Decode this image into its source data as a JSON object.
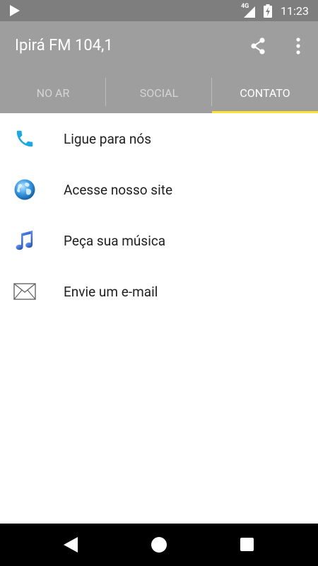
{
  "status_bar": {
    "network_label": "4G",
    "time": "11:23"
  },
  "app_bar": {
    "title": "Ipirá FM 104,1",
    "share_icon": "share-icon",
    "more_icon": "more-vert-icon",
    "background_color": "#9e9e9e"
  },
  "tabs": [
    {
      "label": "NO AR",
      "active": false
    },
    {
      "label": "SOCIAL",
      "active": false
    },
    {
      "label": "CONTATO",
      "active": true
    }
  ],
  "tab_indicator_color": "#fde135",
  "contact_items": [
    {
      "label": "Ligue para nós",
      "icon": "phone-icon"
    },
    {
      "label": "Acesse nosso site",
      "icon": "globe-icon"
    },
    {
      "label": "Peça sua música",
      "icon": "music-note-icon"
    },
    {
      "label": "Envie um e-mail",
      "icon": "envelope-icon"
    }
  ],
  "nav_bar": {
    "back_icon": "back-icon",
    "home_icon": "home-icon",
    "recents_icon": "recents-icon"
  }
}
